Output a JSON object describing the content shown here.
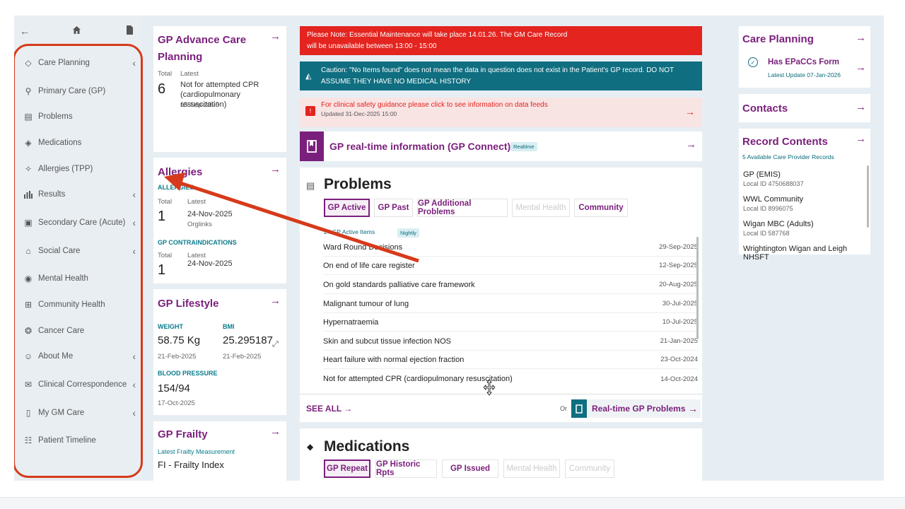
{
  "sidebar": {
    "items": [
      {
        "label": "Care Planning",
        "chevron": true
      },
      {
        "label": "Primary Care (GP)",
        "chevron": false
      },
      {
        "label": "Problems",
        "chevron": false
      },
      {
        "label": "Medications",
        "chevron": false
      },
      {
        "label": "Allergies (TPP)",
        "chevron": false
      },
      {
        "label": "Results",
        "chevron": true
      },
      {
        "label": "Secondary Care (Acute)",
        "chevron": true
      },
      {
        "label": "Social Care",
        "chevron": true
      },
      {
        "label": "Mental Health",
        "chevron": false
      },
      {
        "label": "Community Health",
        "chevron": false
      },
      {
        "label": "Cancer Care",
        "chevron": false
      },
      {
        "label": "About Me",
        "chevron": true
      },
      {
        "label": "Clinical Correspondence",
        "chevron": true
      },
      {
        "label": "My GM Care",
        "chevron": true
      },
      {
        "label": "Patient Timeline",
        "chevron": false
      }
    ]
  },
  "advance_care": {
    "title": "GP Advance Care Planning",
    "total_label": "Total",
    "latest_label": "Latest",
    "total": "6",
    "latest": "Not for attempted CPR (cardiopulmonary resuscitation)",
    "date": "15-Sep-2025"
  },
  "allergies": {
    "title": "Allergies",
    "section1": "ALLERGIES",
    "total_label": "Total",
    "latest_label": "Latest",
    "total": "1",
    "date": "24-Nov-2025",
    "source": "Orglinks",
    "section2": "GP CONTRAINDICATIONS",
    "total2": "1",
    "date2": "24-Nov-2025"
  },
  "lifestyle": {
    "title": "GP Lifestyle",
    "weight_label": "WEIGHT",
    "weight": "58.75 Kg",
    "weight_date": "21-Feb-2025",
    "bmi_label": "BMI",
    "bmi": "25.295187",
    "bmi_date": "21-Feb-2025",
    "bp_label": "BLOOD PRESSURE",
    "bp": "154/94",
    "bp_date": "17-Oct-2025"
  },
  "frailty": {
    "title": "GP Frailty",
    "sub": "Latest Frailty Measurement",
    "value": "FI - Frailty Index"
  },
  "banners": {
    "red_line1": "Please Note: Essential Maintenance will take place 14.01.26. The GM Care Record",
    "red_line2": "will be unavailable between 13:00 - 15:00",
    "teal_line1": "Caution: \"No Items found\" does not mean the data in question does not exist in the Patient's GP record. DO NOT",
    "teal_line2": "ASSUME THEY HAVE NO MEDICAL HISTORY",
    "pink_line1": "For clinical safety guidance please click to see information on data feeds",
    "pink_line2": "Updated 31-Dec-2025 15:00"
  },
  "gp_connect": {
    "title": "GP real-time information (GP Connect)",
    "badge": "Realtime"
  },
  "problems": {
    "title": "Problems",
    "tabs": [
      "GP Active",
      "GP Past",
      "GP Additional Problems",
      "Mental Health",
      "Community"
    ],
    "count_label": "24 GP Active Items",
    "badge": "Nightly",
    "rows": [
      {
        "name": "Ward Round Decisions",
        "date": "29-Sep-2025"
      },
      {
        "name": "On end of life care register",
        "date": "12-Sep-2025"
      },
      {
        "name": "On gold standards palliative care framework",
        "date": "20-Aug-2025"
      },
      {
        "name": "Malignant tumour of lung",
        "date": "30-Jul-2025"
      },
      {
        "name": "Hypernatraemia",
        "date": "10-Jul-2025"
      },
      {
        "name": "Skin and subcut tissue infection NOS",
        "date": "21-Jan-2025"
      },
      {
        "name": "Heart failure with normal ejection fraction",
        "date": "23-Oct-2024"
      },
      {
        "name": "Not for attempted CPR (cardiopulmonary resuscitation)",
        "date": "14-Oct-2024"
      }
    ],
    "see_all": "SEE ALL",
    "or": "Or",
    "realtime_link": "Real-time GP Problems"
  },
  "medications": {
    "title": "Medications",
    "tabs": [
      "GP Repeat",
      "GP Historic Rpts",
      "GP Issued",
      "Mental Health",
      "Community"
    ]
  },
  "care_planning": {
    "title": "Care Planning",
    "item": "Has EPaCCs Form",
    "item_sub": "Latest Update 07-Jan-2026"
  },
  "contacts": {
    "title": "Contacts"
  },
  "record_contents": {
    "title": "Record Contents",
    "sub": "5 Available Care Provider Records",
    "items": [
      {
        "name": "GP (EMIS)",
        "id": "Local ID 4750688037"
      },
      {
        "name": "WWL Community",
        "id": "Local ID 8996075"
      },
      {
        "name": "Wigan MBC (Adults)",
        "id": "Local ID 587768"
      },
      {
        "name": "Wrightington Wigan and Leigh NHSFT",
        "id": ""
      }
    ]
  },
  "colors": {
    "brand": "#7a1f7c",
    "alert_red": "#e3241f",
    "teal": "#0f6e80",
    "annotation": "#d63a1a"
  }
}
